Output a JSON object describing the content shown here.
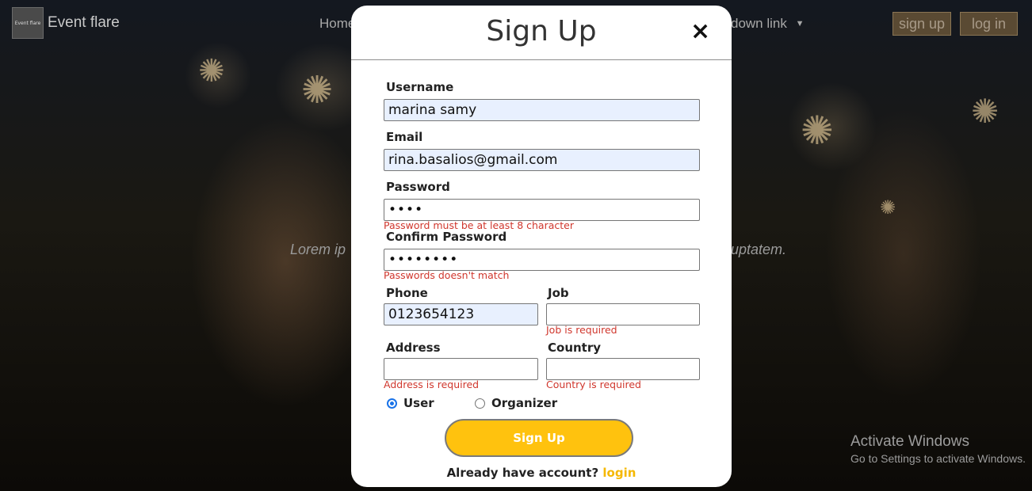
{
  "navbar": {
    "brand_logo_text": "Event flare",
    "brand_name": "Event flare",
    "home_link": "Home",
    "dropdown_link": "down link",
    "signup_button": "sign up",
    "login_button": "log in"
  },
  "hero": {
    "text_left": "Lorem ip",
    "text_right": "uptatem."
  },
  "modal": {
    "title": "Sign Up",
    "close_glyph": "×",
    "fields": {
      "username": {
        "label": "Username",
        "value": "marina samy"
      },
      "email": {
        "label": "Email",
        "value": "rina.basalios@gmail.com"
      },
      "password": {
        "label": "Password",
        "value": "••••",
        "error": "Password must be at least 8 character"
      },
      "confirm_password": {
        "label": "Confirm Password",
        "value": "••••••••",
        "error": "Passwords doesn't match"
      },
      "phone": {
        "label": "Phone",
        "value": "0123654123"
      },
      "job": {
        "label": "Job",
        "value": "",
        "error": "Job is required"
      },
      "address": {
        "label": "Address",
        "value": "",
        "error": "Address is required"
      },
      "country": {
        "label": "Country",
        "value": "",
        "error": "Country is required"
      }
    },
    "role": {
      "options": [
        "User",
        "Organizer"
      ],
      "selected": "User"
    },
    "submit_label": "Sign Up",
    "footer_text": "Already have account?",
    "footer_link": "login"
  },
  "os_overlay": {
    "line1": "Activate Windows",
    "line2": "Go to Settings to activate Windows."
  },
  "colors": {
    "accent": "#ffc20e",
    "error": "#d0372d",
    "autofill": "#e8f0fe"
  }
}
